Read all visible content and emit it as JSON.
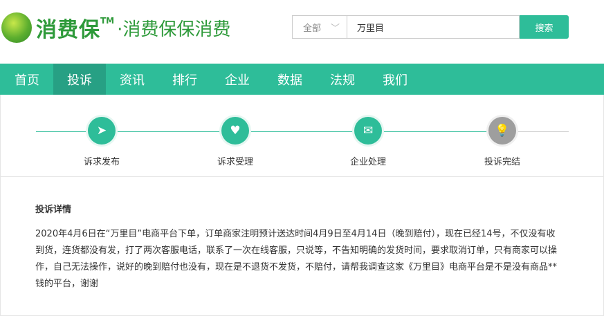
{
  "logo": {
    "brand": "消费保",
    "tm": "TM",
    "slogan": "·消费保保消费"
  },
  "search": {
    "category": "全部",
    "query": "万里目",
    "button": "搜索"
  },
  "nav": [
    "首页",
    "投诉",
    "资讯",
    "排行",
    "企业",
    "数据",
    "法规",
    "我们"
  ],
  "steps": [
    {
      "label": "诉求发布",
      "icon": "paper-plane-icon"
    },
    {
      "label": "诉求受理",
      "icon": "heart-icon"
    },
    {
      "label": "企业处理",
      "icon": "mail-reply-icon"
    },
    {
      "label": "投诉完结",
      "icon": "lightbulb-icon"
    }
  ],
  "detail": {
    "title": "投诉详情",
    "text": "2020年4月6日在“万里目”电商平台下单，订单商家注明预计送达时间4月9日至4月14日（晚到赔付），现在已经14号，不仅没有收到货，连货都没有发，打了两次客服电话，联系了一次在线客服，只说等，不告知明确的发货时间，要求取消订单，只有商家可以操作，自己无法操作，说好的晚到赔付也没有，现在是不退货不发货，不赔付，请帮我调查这家《万里目》电商平台是不是没有商品**钱的平台，谢谢"
  },
  "colors": {
    "accent": "#2ebd99",
    "active": "#27a084",
    "pending": "#9e9e9e"
  }
}
